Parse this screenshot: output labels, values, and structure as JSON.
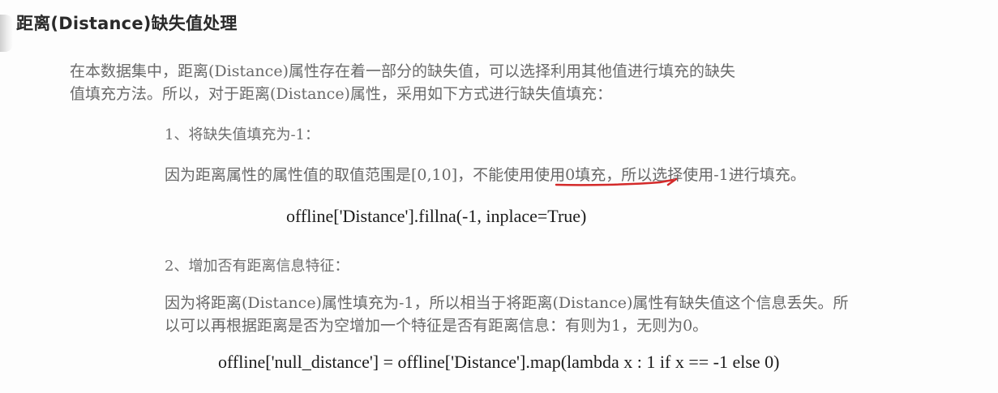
{
  "title": "距离(Distance)缺失值处理",
  "intro": {
    "line1": "在本数据集中，距离(Distance)属性存在着一部分的缺失值，可以选择利用其他值进行填充的缺失",
    "line2": "值填充方法。所以，对于距离(Distance)属性，采用如下方式进行缺失值填充："
  },
  "items": [
    {
      "heading": "1、将缺失值填充为-1：",
      "description": "因为距离属性的属性值的取值范围是[0,10]，不能使用使用0填充，所以选择使用-1进行填充。",
      "code": "offline['Distance'].fillna(-1, inplace=True)"
    },
    {
      "heading": "2、增加否有距离信息特征：",
      "description_line1": "因为将距离(Distance)属性填充为-1，所以相当于将距离(Distance)属性有缺失值这个信息丢失。所",
      "description_line2": "以可以再根据距离是否为空增加一个特征是否有距离信息：有则为1，无则为0。",
      "code": "offline['null_distance'] = offline['Distance'].map(lambda x : 1 if x == -1 else 0)"
    }
  ],
  "annotation_color": "#d42a2a"
}
